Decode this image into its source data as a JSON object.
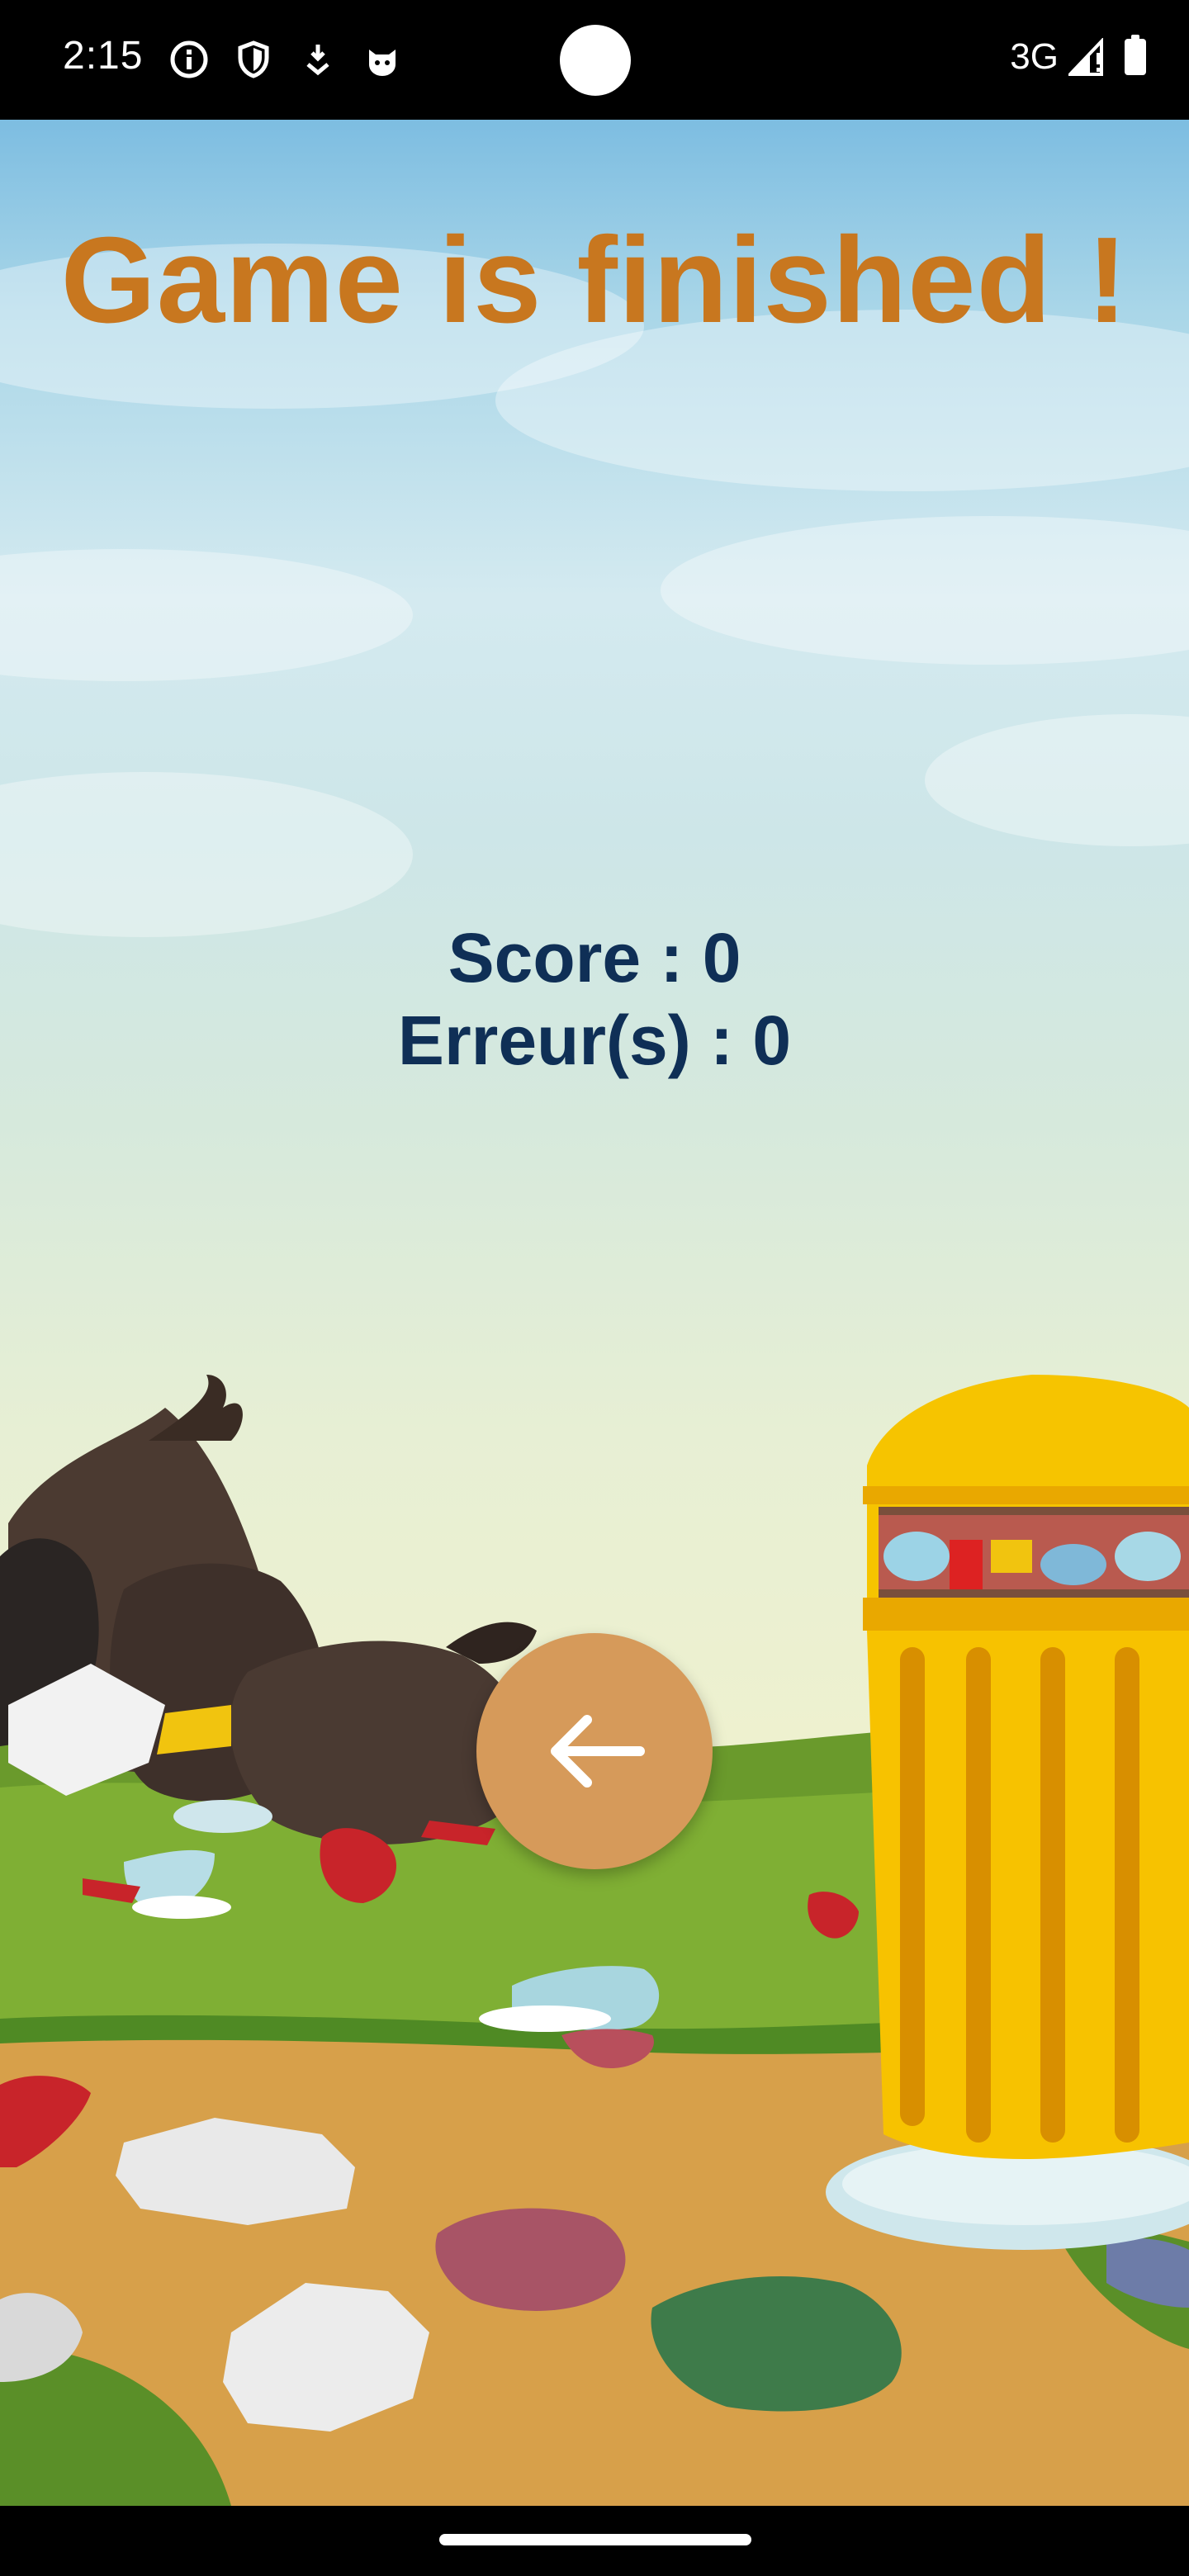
{
  "status_bar": {
    "time": "2:15",
    "left_icons": [
      "info-icon",
      "shield-icon",
      "download-icon",
      "cat-face-icon"
    ],
    "network": "3G",
    "right_icons": [
      "signal-icon",
      "battery-icon"
    ]
  },
  "game": {
    "title": "Game is finished !",
    "score_label": "Score : 0",
    "errors_label": "Erreur(s) : 0",
    "back_button_icon": "arrow-left-icon",
    "colors": {
      "title": "#c8771f",
      "score_text": "#0f2f56",
      "back_button": "#d69a5a",
      "trash_bin": "#f5b800"
    }
  }
}
